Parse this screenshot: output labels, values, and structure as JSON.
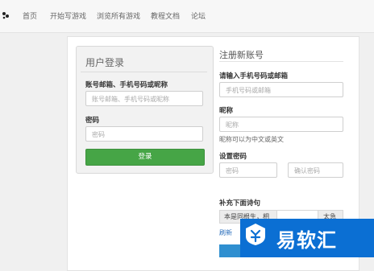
{
  "nav": {
    "items": [
      "首页",
      "开始写游戏",
      "浏览所有游戏",
      "教程文档",
      "论坛"
    ]
  },
  "login": {
    "title": "用户登录",
    "account_label": "账号邮箱、手机号码或昵称",
    "account_placeholder": "账号邮箱、手机号码或昵称",
    "password_label": "密码",
    "password_placeholder": "密码",
    "submit_label": "登录"
  },
  "register": {
    "title": "注册新账号",
    "contact_label": "请输入手机号码或邮箱",
    "contact_placeholder": "手机号码或邮箱",
    "nickname_label": "昵称",
    "nickname_placeholder": "昵称",
    "nickname_hint": "昵称可以为中文或英文",
    "password_label": "设置密码",
    "password_placeholder": "密码",
    "confirm_placeholder": "确认密码",
    "poem_label": "补充下面诗句",
    "poem_prefix": "本是同根生，相",
    "poem_suffix": "太急",
    "refresh_label": "刷新"
  },
  "watermark": {
    "text": "易软汇"
  },
  "colors": {
    "login_button": "#46a546",
    "link": "#2a6ebb",
    "watermark_bg": "#0b6fd3"
  }
}
